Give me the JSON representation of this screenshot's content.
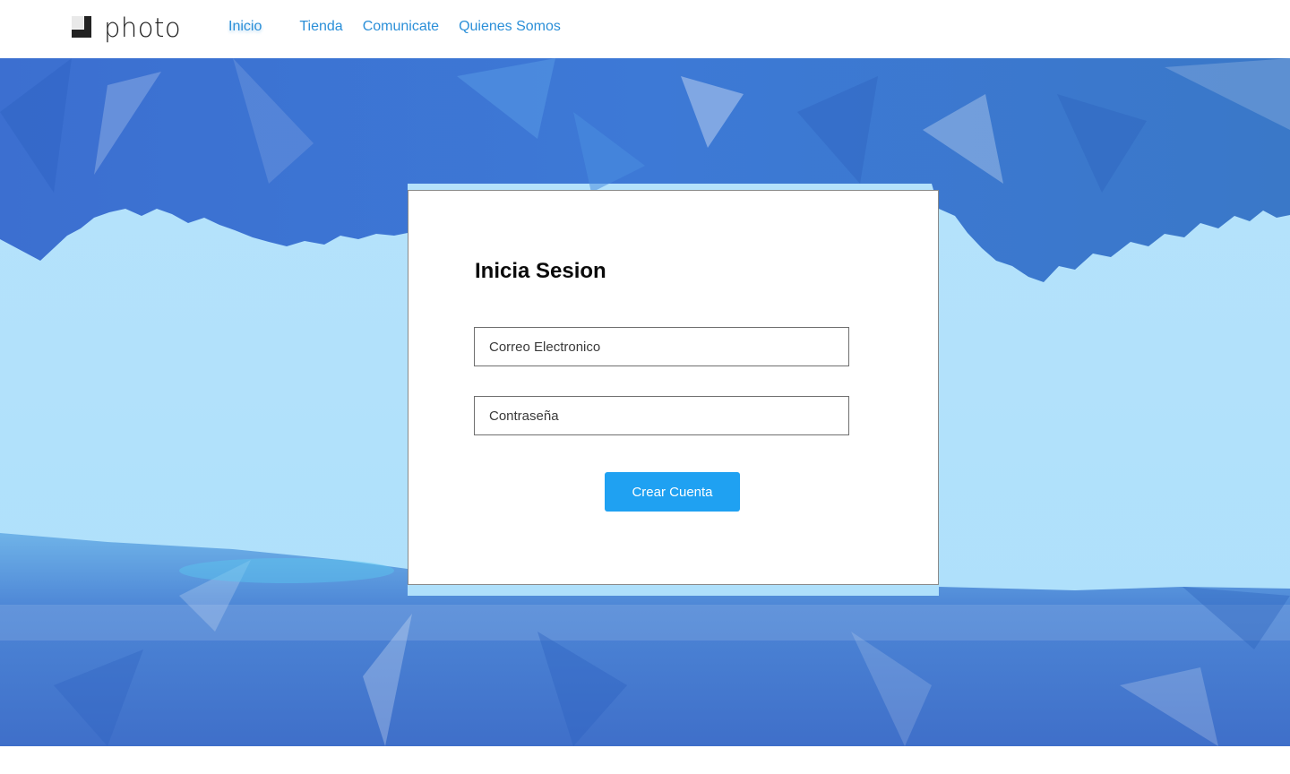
{
  "header": {
    "logo_text": "photo",
    "nav": [
      {
        "label": "Inicio",
        "active": true
      },
      {
        "label": "Tienda",
        "active": false
      },
      {
        "label": "Comunicate",
        "active": false
      },
      {
        "label": "Quienes Somos",
        "active": false
      }
    ]
  },
  "login": {
    "title": "Inicia Sesion",
    "email_placeholder": "Correo Electronico",
    "password_placeholder": "Contraseña",
    "submit_label": "Crear Cuenta"
  },
  "colors": {
    "nav_link": "#2b8fd8",
    "button": "#1fa1f2",
    "sky_light": "#b3e0fb",
    "sky_dark": "#3a72cf"
  },
  "icons": {
    "logo": "photo-squares-icon"
  }
}
